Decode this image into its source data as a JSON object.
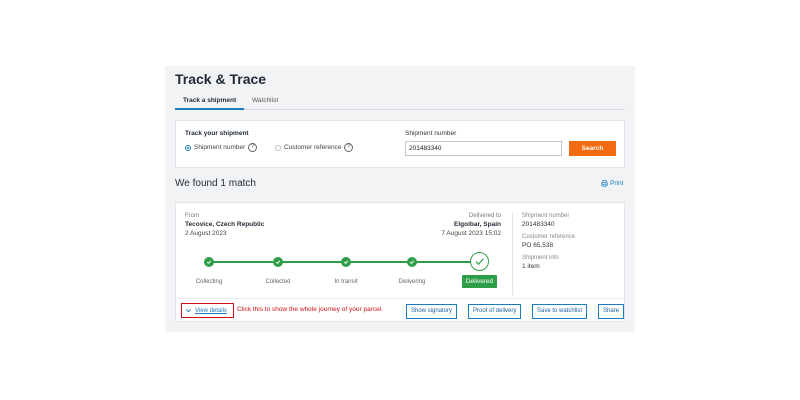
{
  "header": {
    "title": "Track & Trace"
  },
  "tabs": [
    {
      "label": "Track a shipment"
    },
    {
      "label": "Watchlist"
    }
  ],
  "search": {
    "section_label": "Track your shipment",
    "radio_shipment": "Shipment number",
    "radio_reference": "Customer reference",
    "help_glyph": "?",
    "shipment_number_label": "Shipment number",
    "shipment_number_value": "201483340",
    "search_button": "Search"
  },
  "results": {
    "found_text": "We found 1 match",
    "print_label": "Print"
  },
  "shipment": {
    "from_label": "From",
    "from_value": "Tecovice, Czech Republic",
    "from_date": "2 August 2023",
    "to_label": "Delivered to",
    "to_value": "Elgoibar, Spain",
    "to_date": "7 August 2023 15:02",
    "info": [
      {
        "key": "Shipment number",
        "value": "201483340"
      },
      {
        "key": "Customer reference",
        "value": "PO 65.538"
      },
      {
        "key": "Shipment info",
        "value": "1 item"
      }
    ],
    "steps": [
      "Collecting",
      "Collected",
      "In transit",
      "Delivering",
      "Delivered"
    ],
    "progress": 1.0
  },
  "actions": {
    "view_details": "View details",
    "annotation": "Click this to show the whole journey of your parcel.",
    "show_signatory": "Show signatory",
    "proof_of_delivery": "Proof of delivery",
    "save_to_watchlist": "Save to watchlist",
    "share": "Share"
  },
  "colors": {
    "accent": "#1a7bbf",
    "search_button": "#f26b10",
    "success": "#2e9e49",
    "annotation": "#d0101b"
  }
}
